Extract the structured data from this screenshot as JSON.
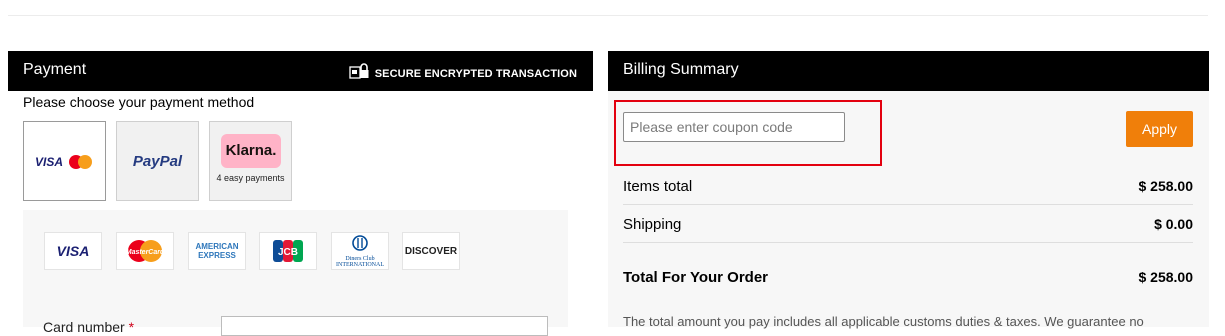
{
  "payment": {
    "title": "Payment",
    "secure_label": "SECURE ENCRYPTED TRANSACTION",
    "choose_label": "Please choose your payment method",
    "methods": {
      "visa_mastercard": {
        "label": "VISA"
      },
      "paypal": {
        "label": "PayPal"
      },
      "klarna": {
        "label": "Klarna.",
        "sub": "4 easy payments"
      }
    },
    "accepted_cards": [
      "VISA",
      "MasterCard",
      "AMERICAN EXPRESS",
      "JCB",
      "Diners Club INTERNATIONAL",
      "DISCOVER"
    ],
    "card_number_label": "Card number",
    "required_mark": "*"
  },
  "billing": {
    "title": "Billing Summary",
    "coupon_placeholder": "Please enter coupon code",
    "apply_label": "Apply",
    "items_total_label": "Items total",
    "items_total_value": "$ 258.00",
    "shipping_label": "Shipping",
    "shipping_value": "$ 0.00",
    "total_label": "Total For Your Order",
    "total_value": "$ 258.00",
    "note": "The total amount you pay includes all applicable customs duties & taxes. We guarantee no"
  },
  "colors": {
    "header_bg": "#000000",
    "apply_button": "#f07f0a",
    "highlight_border": "#e3000f",
    "paypal_blue": "#253b80",
    "klarna_pink": "#ffb3c7"
  }
}
